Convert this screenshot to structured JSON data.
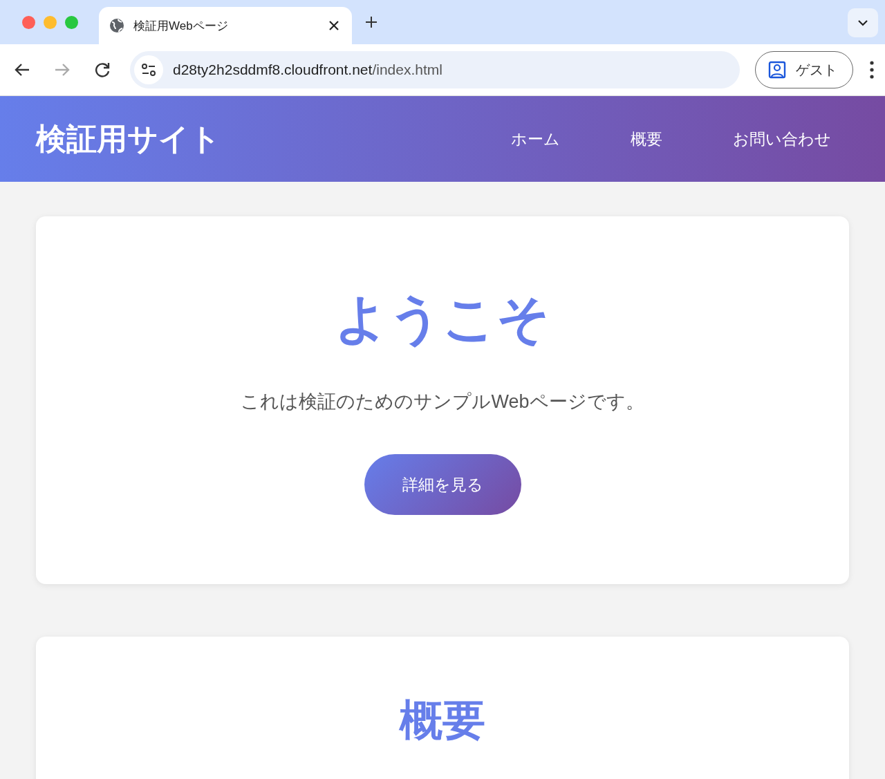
{
  "browser": {
    "tab": {
      "title": "検証用Webページ",
      "selected": true
    },
    "url_host": "d28ty2h2sddmf8.cloudfront.net",
    "url_path": "/index.html",
    "profile": "ゲスト"
  },
  "header": {
    "logo": "検証用サイト",
    "nav": [
      "ホーム",
      "概要",
      "お問い合わせ"
    ]
  },
  "hero": {
    "title": "ようこそ",
    "text": "これは検証のためのサンプルWebページです。",
    "button": "詳細を見る"
  },
  "about": {
    "title": "概要"
  }
}
